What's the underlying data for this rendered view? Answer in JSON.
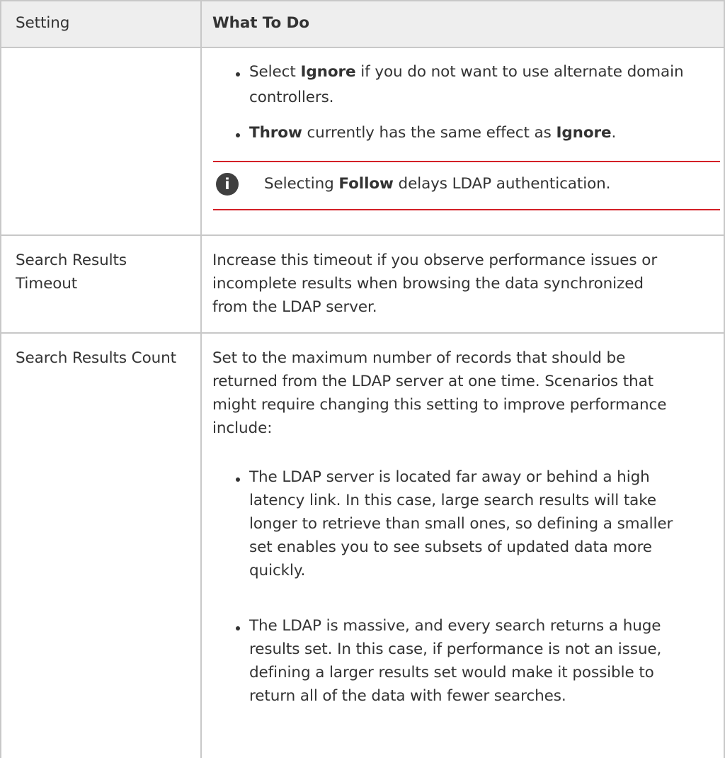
{
  "table": {
    "header": {
      "setting": "Setting",
      "what_to_do": "What To Do"
    },
    "rows": [
      {
        "setting": "",
        "bullets": [
          {
            "pre": "Select ",
            "bold": "Ignore",
            "post": " if you do not want to use alternate domain",
            "line2": "controllers."
          },
          {
            "bold1": "Throw",
            "mid": " currently has the same effect as ",
            "bold2": "Ignore",
            "end": "."
          }
        ],
        "note": {
          "icon": "info-icon",
          "pre": "Selecting ",
          "bold": "Follow",
          "post": " delays LDAP authentication."
        }
      },
      {
        "setting_lines": [
          "Search Results",
          "Timeout"
        ],
        "lines": [
          "Increase this timeout if you observe performance issues or",
          "incomplete results when browsing the data synchronized",
          "from the LDAP server."
        ]
      },
      {
        "setting_lines": [
          "Search Results Count"
        ],
        "intro_lines": [
          "Set to the maximum number of records that should be",
          "returned from the LDAP server at one time. Scenarios that",
          "might require changing this setting to improve performance",
          "include:"
        ],
        "bullets": [
          {
            "lines": [
              "The LDAP server is located far away or behind a high",
              "latency link. In this case, large search results will take",
              "longer to retrieve than small ones, so defining a smaller",
              "set enables you to see subsets of updated data more",
              "quickly."
            ]
          },
          {
            "lines": [
              "The LDAP is massive, and every search returns a huge",
              "results set. In this case, if performance is not an issue,",
              "defining a larger results set would make it possible to",
              "return all of the data with fewer searches."
            ]
          }
        ]
      }
    ]
  },
  "colors": {
    "border": "#c8c8c8",
    "header_bg": "#eeeeee",
    "note_rule": "#d32027",
    "text": "#333333"
  }
}
